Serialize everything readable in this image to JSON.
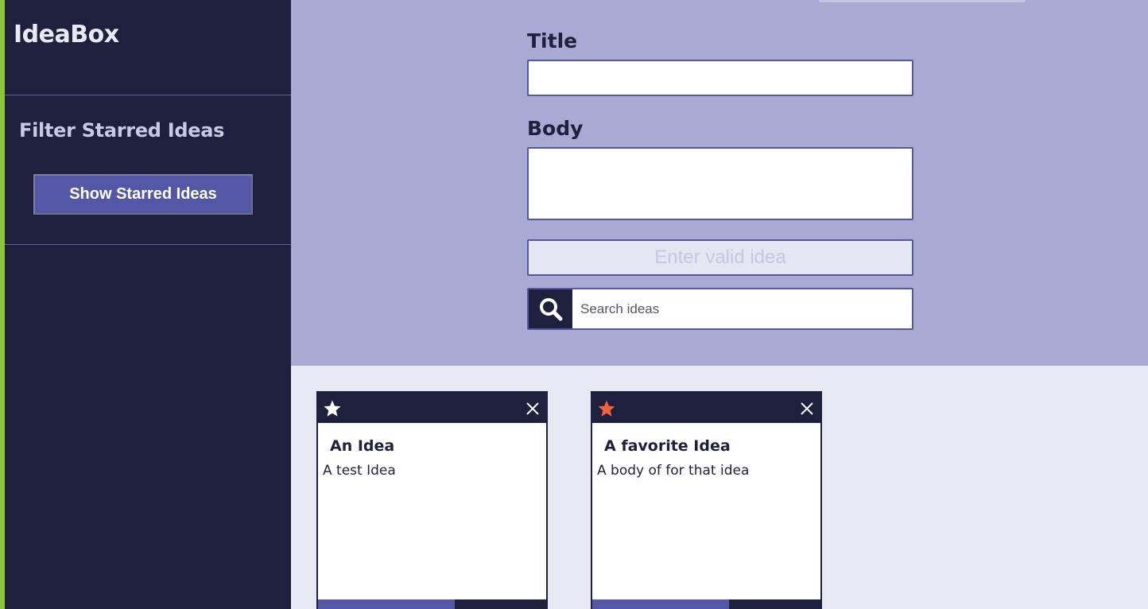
{
  "app": {
    "title": "IdeaBox"
  },
  "sidebar": {
    "filter_heading": "Filter Starred Ideas",
    "show_starred_label": "Show Starred Ideas"
  },
  "form": {
    "title_label": "Title",
    "title_value": "",
    "body_label": "Body",
    "body_value": "",
    "save_label": "Enter valid idea",
    "search_placeholder": "Search ideas",
    "search_value": ""
  },
  "cards": [
    {
      "title": "An Idea",
      "body": "A test Idea",
      "starred": false,
      "star_icon": "star-icon",
      "close_icon": "close-icon"
    },
    {
      "title": "A favorite Idea",
      "body": "A body of for that idea",
      "starred": true,
      "star_icon": "star-icon",
      "close_icon": "close-icon"
    }
  ],
  "colors": {
    "sidebar_bg": "#1F1F3E",
    "accent": "#5457A6",
    "top_region_bg": "#A8AAD4",
    "card_area_bg": "#E9E9F3",
    "star_active": "#F0623A",
    "star_inactive": "#FFFFFF",
    "left_edge": "#8CC43C"
  }
}
